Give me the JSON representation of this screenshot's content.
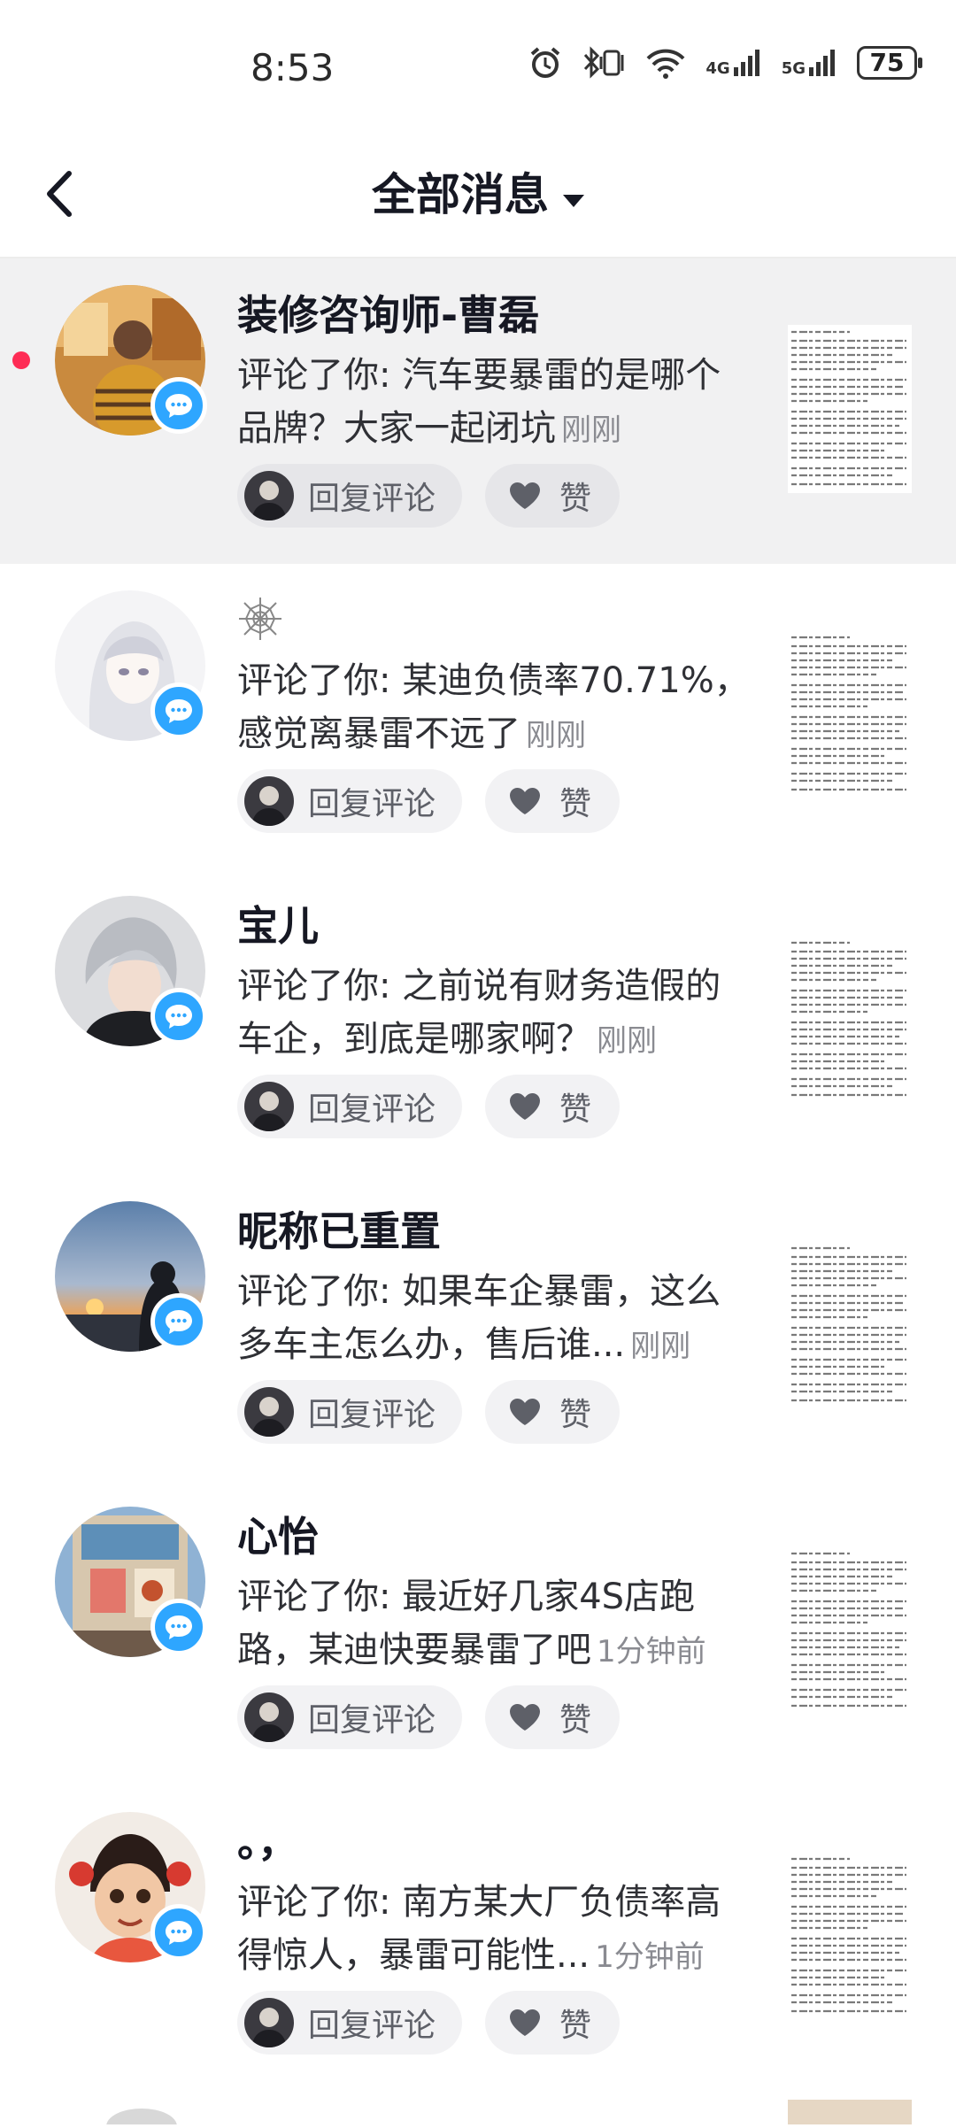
{
  "status_bar": {
    "time": "8:53",
    "battery": "75",
    "net1": "4G",
    "net2": "5G"
  },
  "header": {
    "title": "全部消息"
  },
  "messages": [
    {
      "name": "装修咨询师-曹磊",
      "comment": "评论了你: 汽车要暴雷的是哪个品牌？大家一起闭坑",
      "time": "刚刚",
      "reply_label": "回复评论",
      "like_label": "赞",
      "unread": true
    },
    {
      "name": "",
      "comment": "评论了你: 某迪负债率70.71%，感觉离暴雷不远了",
      "time": "刚刚",
      "reply_label": "回复评论",
      "like_label": "赞",
      "unread": false
    },
    {
      "name": "宝儿",
      "comment": "评论了你: 之前说有财务造假的车企，到底是哪家啊？",
      "time": "刚刚",
      "reply_label": "回复评论",
      "like_label": "赞",
      "unread": false
    },
    {
      "name": "昵称已重置",
      "comment": "评论了你: 如果车企暴雷，这么多车主怎么办，售后谁...",
      "time": "刚刚",
      "reply_label": "回复评论",
      "like_label": "赞",
      "unread": false
    },
    {
      "name": "心怡",
      "comment": "评论了你: 最近好几家4S店跑路，某迪快要暴雷了吧",
      "time": "1分钟前",
      "reply_label": "回复评论",
      "like_label": "赞",
      "unread": false
    },
    {
      "name": "。，",
      "comment": "评论了你: 南方某大厂负债率高得惊人，暴雷可能性...",
      "time": "1分钟前",
      "reply_label": "回复评论",
      "like_label": "赞",
      "unread": false
    }
  ]
}
